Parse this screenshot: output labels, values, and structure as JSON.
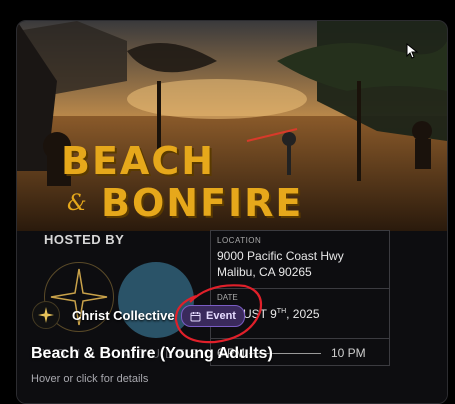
{
  "banner": {
    "word1": "BEACH",
    "amp": "&",
    "word2": "BONFIRE"
  },
  "hosted_by_label": "HOSTED BY",
  "young_adults_text": "YOUNG ADULTS",
  "location": {
    "label": "LOCATION",
    "line1": "9000 Pacific Coast Hwy",
    "line2": "Malibu, CA 90265"
  },
  "date": {
    "label": "DATE",
    "month_day": "AUGUST 9",
    "suffix": "TH",
    "year": ", 2025"
  },
  "time": {
    "start": "6 PM",
    "end": "10 PM"
  },
  "organizer": {
    "name": "Christ Collective",
    "icon": "star-compass-icon"
  },
  "event_badge": {
    "label": "Event",
    "icon": "calendar-icon"
  },
  "event_title": "Beach & Bonfire (Young Adults)",
  "hint_text": "Hover or click for details",
  "colors": {
    "accent": "#e6a81b",
    "badge_bg": "#3a2a5c",
    "badge_border": "#7a5cc4",
    "annotation": "#e0202a"
  }
}
